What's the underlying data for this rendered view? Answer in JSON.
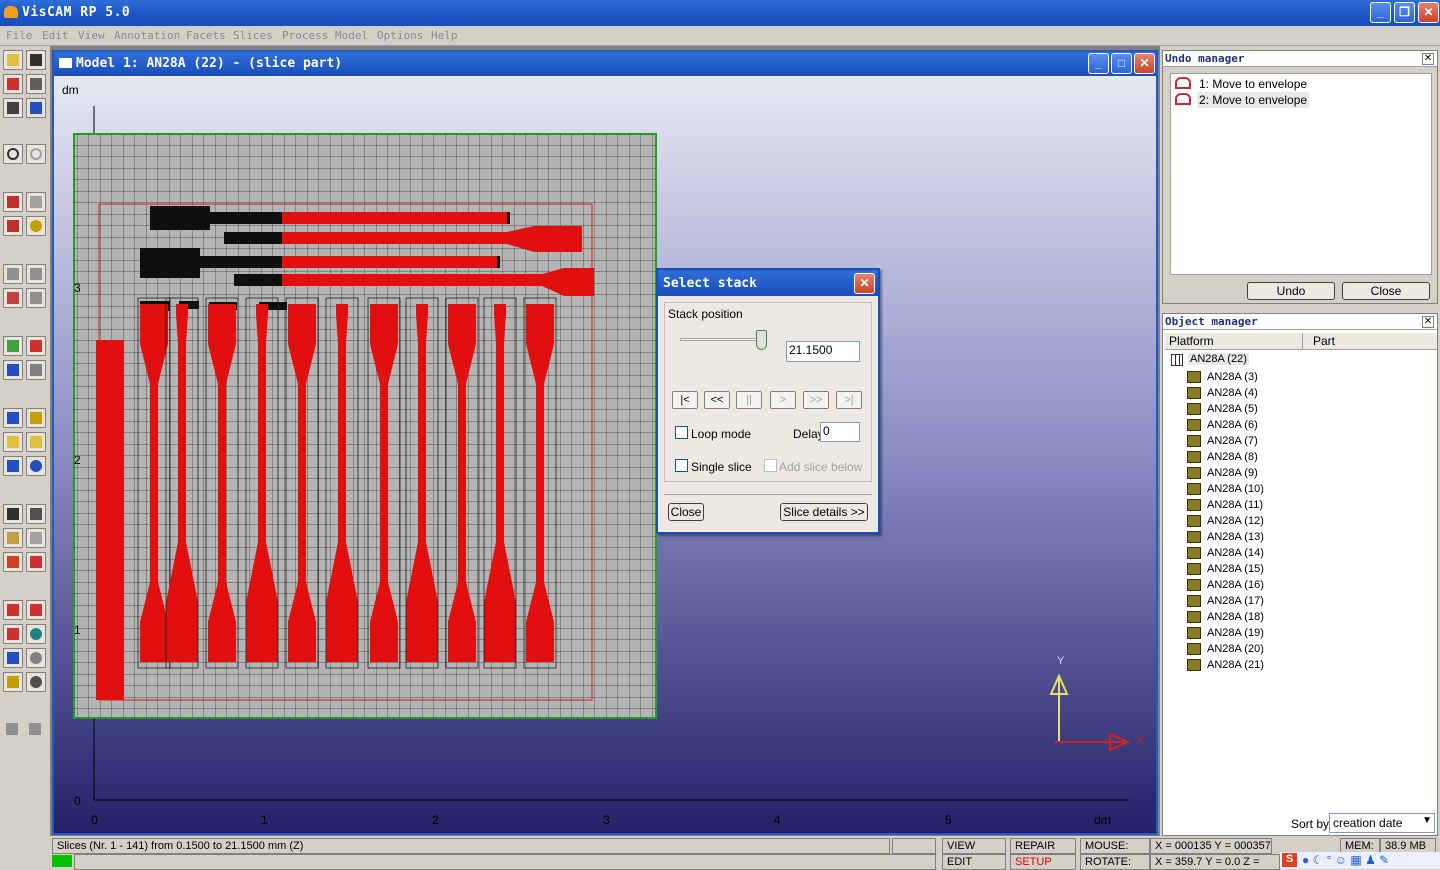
{
  "app": {
    "title": "VisCAM RP 5.0"
  },
  "menu": [
    "File",
    "Edit",
    "View",
    "Annotation",
    "Facets",
    "Slices",
    "Process",
    "Model",
    "Options",
    "Help"
  ],
  "model_window": {
    "title": "Model 1: AN28A (22) - (slice part)",
    "axis_unit_top": "dm",
    "axis_unit_bottom": "dm",
    "y_ticks": [
      "3",
      "2",
      "1",
      "0"
    ],
    "x_ticks": [
      "0",
      "1",
      "2",
      "3",
      "4",
      "5"
    ],
    "axis_y_label": "Y",
    "axis_x_label": "X"
  },
  "select_stack": {
    "title": "Select stack",
    "group_label": "Stack position",
    "position_value": "21.1500",
    "slider_fraction": 1.0,
    "nav_buttons": [
      "|<",
      "<<",
      "||",
      ">",
      ">>",
      ">|"
    ],
    "loop_mode_label": "Loop mode",
    "delay_label": "Delay time",
    "delay_value": "0",
    "single_slice_label": "Single slice",
    "add_slice_below_label": "Add slice below",
    "close_label": "Close",
    "details_label": "Slice details >>"
  },
  "undo_manager": {
    "title": "Undo manager",
    "items": [
      "1: Move to envelope",
      "2: Move to envelope"
    ],
    "undo_label": "Undo",
    "close_label": "Close"
  },
  "object_manager": {
    "title": "Object manager",
    "columns": [
      "Platform",
      "Part"
    ],
    "root": "AN28A (22)",
    "parts": [
      "AN28A (3)",
      "AN28A (4)",
      "AN28A (5)",
      "AN28A (6)",
      "AN28A (7)",
      "AN28A (8)",
      "AN28A (9)",
      "AN28A (10)",
      "AN28A (11)",
      "AN28A (12)",
      "AN28A (13)",
      "AN28A (14)",
      "AN28A (15)",
      "AN28A (16)",
      "AN28A (17)",
      "AN28A (18)",
      "AN28A (19)",
      "AN28A (20)",
      "AN28A (21)"
    ],
    "sort_label": "Sort by",
    "sort_value": "creation date"
  },
  "status": {
    "slices_text": "Slices (Nr. 1 - 141) from 0.1500 to 21.1500 mm (Z)",
    "view": "VIEW",
    "edit": "EDIT",
    "repair": "REPAIR",
    "setup": "SETUP",
    "mouse_label": "MOUSE:",
    "rotate_label": "ROTATE:",
    "mouse_value": "X = 000135   Y = 000357",
    "rotate_value": "X = 359.7   Y = 0.0   Z =",
    "mem_label": "MEM:",
    "mem_value": "38.9 MB",
    "setup_color": "#e00000"
  }
}
